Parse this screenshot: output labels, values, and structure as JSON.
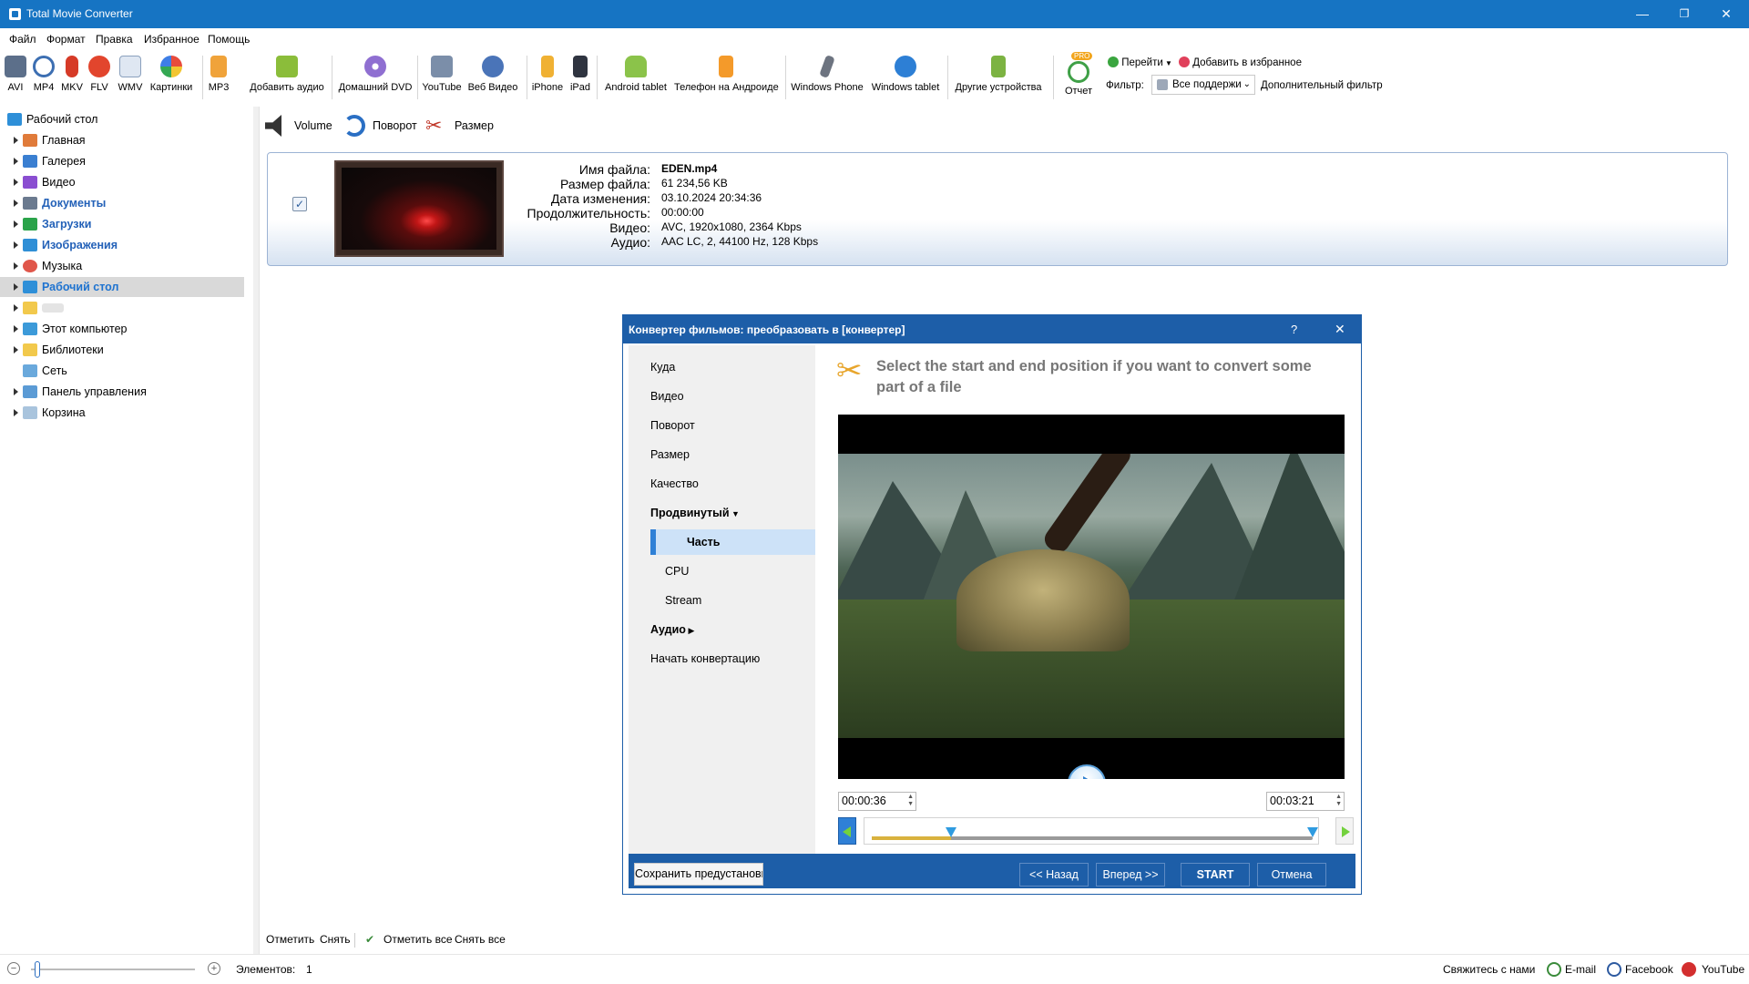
{
  "app": {
    "title": "Total Movie Converter"
  },
  "window_controls": {
    "minimize": "—",
    "restore": "❐",
    "close": "✕"
  },
  "menu": [
    "Файл",
    "Формат",
    "Правка",
    "Избранное",
    "Помощь"
  ],
  "toolbar": {
    "formats": [
      "AVI",
      "MP4",
      "MKV",
      "FLV",
      "WMV",
      "Картинки",
      "MP3"
    ],
    "add_audio": "Добавить аудио",
    "home_dvd": "Домашний DVD",
    "youtube": "YouTube",
    "web_video": "Веб Видео",
    "iphone": "iPhone",
    "ipad": "iPad",
    "android_tablet": "Android tablet",
    "android_phone": "Телефон на Андроиде",
    "windows_phone": "Windows Phone",
    "windows_tablet": "Windows tablet",
    "other_devices": "Другие устройства",
    "report": "Отчет",
    "pro_badge": "PRO",
    "goto": "Перейти",
    "add_favorites": "Добавить в избранное",
    "filter_label": "Фильтр:",
    "filter_value": "Все поддержи",
    "extra_filter": "Дополнительный фильтр"
  },
  "tree": {
    "root": "Рабочий стол",
    "items": [
      {
        "label": "Главная",
        "bold": false
      },
      {
        "label": "Галерея",
        "bold": false
      },
      {
        "label": "Видео",
        "bold": false
      },
      {
        "label": "Документы",
        "bold": true
      },
      {
        "label": "Загрузки",
        "bold": true
      },
      {
        "label": "Изображения",
        "bold": true
      },
      {
        "label": "Музыка",
        "bold": false
      },
      {
        "label": "Рабочий стол",
        "bold": true,
        "selected": true
      },
      {
        "label": "",
        "bold": false
      },
      {
        "label": "Этот компьютер",
        "bold": false
      },
      {
        "label": "Библиотеки",
        "bold": false
      },
      {
        "label": "Сеть",
        "bold": false
      },
      {
        "label": "Панель управления",
        "bold": false
      },
      {
        "label": "Корзина",
        "bold": false
      }
    ]
  },
  "subbar": {
    "volume": "Volume",
    "rotate": "Поворот",
    "size": "Размер"
  },
  "file": {
    "name_label": "Имя файла:",
    "name": "EDEN.mp4",
    "size_label": "Размер файла:",
    "size": "61 234,56 KB",
    "date_label": "Дата изменения:",
    "date": "03.10.2024 20:34:36",
    "duration_label": "Продолжительность:",
    "duration": "00:00:00",
    "video_label": "Видео:",
    "video": "AVC, 1920x1080, 2364 Kbps",
    "audio_label": "Аудио:",
    "audio": "AAC LC, 2, 44100 Hz, 128 Kbps",
    "checked": true
  },
  "pane_actions": {
    "mark": "Отметить",
    "unmark": "Снять",
    "mark_all": "Отметить все",
    "unmark_all": "Снять все"
  },
  "status": {
    "items_label": "Элементов:",
    "items_count": "1",
    "contact": "Свяжитесь с нами",
    "email": "E-mail",
    "facebook": "Facebook",
    "youtube": "YouTube"
  },
  "dialog": {
    "title": "Конвертер фильмов: преобразовать в [конвертер]",
    "help": "?",
    "close": "✕",
    "nav": [
      "Куда",
      "Видео",
      "Поворот",
      "Размер",
      "Качество",
      "Продвинутый",
      "Часть",
      "CPU",
      "Stream",
      "Аудио",
      "Начать конвертацию"
    ],
    "selected_nav": "Часть",
    "instruction": "Select the start and end position if you want to convert some part of a file",
    "start_time": "00:00:36",
    "end_time": "00:03:21",
    "selection_start_fraction": 0.18,
    "selection_end_fraction": 1.0,
    "save_preset": "Сохранить предустановк",
    "back": "<< Назад",
    "forward": "Вперед >>",
    "start": "START",
    "cancel": "Отмена"
  },
  "colors": {
    "titlebar": "#1674c3",
    "dialog_accent": "#1d5ea8",
    "selection": "#cde2f8",
    "blue_text": "#2361b8"
  }
}
